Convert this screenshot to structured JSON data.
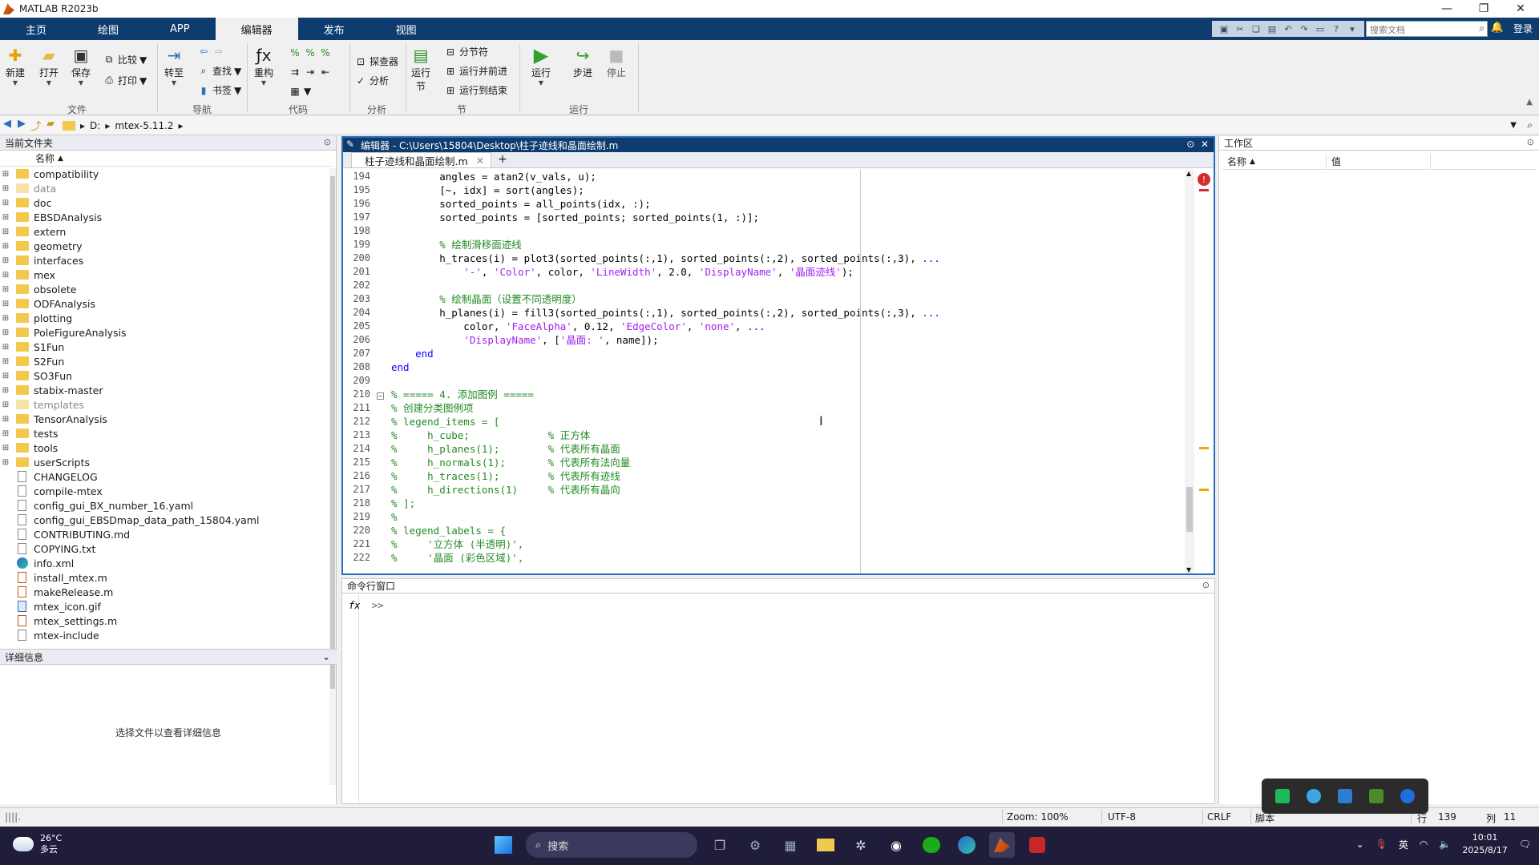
{
  "window": {
    "title": "MATLAB R2023b"
  },
  "tabs": [
    "主页",
    "绘图",
    "APP",
    "编辑器",
    "发布",
    "视图"
  ],
  "active_tab": "编辑器",
  "search": {
    "placeholder": "搜索文档"
  },
  "login": "登录",
  "ribbon": {
    "file": {
      "new": "新建",
      "open": "打开",
      "save": "保存",
      "compare": "比较",
      "print": "打印",
      "group": "文件"
    },
    "nav": {
      "goto": "转至",
      "find": "查找",
      "bookmark": "书签",
      "group": "导航"
    },
    "code": {
      "refactor": "重构",
      "group": "代码"
    },
    "analyze": {
      "explorer": "探查器",
      "analyze": "分析",
      "group": "分析"
    },
    "section": {
      "run_section": "运行节",
      "break": "分节符",
      "run_advance": "运行并前进",
      "run_to_end": "运行到结束",
      "group": "节"
    },
    "run": {
      "run": "运行",
      "step": "步进",
      "stop": "停止",
      "group": "运行"
    }
  },
  "address": {
    "drive": "D:",
    "folder": "mtex-5.11.2"
  },
  "current_folder": {
    "title": "当前文件夹",
    "column": "名称",
    "items": [
      {
        "name": "compatibility",
        "type": "folder"
      },
      {
        "name": "data",
        "type": "folder-dim"
      },
      {
        "name": "doc",
        "type": "folder"
      },
      {
        "name": "EBSDAnalysis",
        "type": "folder"
      },
      {
        "name": "extern",
        "type": "folder"
      },
      {
        "name": "geometry",
        "type": "folder"
      },
      {
        "name": "interfaces",
        "type": "folder"
      },
      {
        "name": "mex",
        "type": "folder"
      },
      {
        "name": "obsolete",
        "type": "folder"
      },
      {
        "name": "ODFAnalysis",
        "type": "folder"
      },
      {
        "name": "plotting",
        "type": "folder"
      },
      {
        "name": "PoleFigureAnalysis",
        "type": "folder"
      },
      {
        "name": "S1Fun",
        "type": "folder"
      },
      {
        "name": "S2Fun",
        "type": "folder"
      },
      {
        "name": "SO3Fun",
        "type": "folder"
      },
      {
        "name": "stabix-master",
        "type": "folder"
      },
      {
        "name": "templates",
        "type": "folder-dim"
      },
      {
        "name": "TensorAnalysis",
        "type": "folder"
      },
      {
        "name": "tests",
        "type": "folder"
      },
      {
        "name": "tools",
        "type": "folder"
      },
      {
        "name": "userScripts",
        "type": "folder"
      },
      {
        "name": "CHANGELOG",
        "type": "file"
      },
      {
        "name": "compile-mtex",
        "type": "file"
      },
      {
        "name": "config_gui_BX_number_16.yaml",
        "type": "file"
      },
      {
        "name": "config_gui_EBSDmap_data_path_15804.yaml",
        "type": "file"
      },
      {
        "name": "CONTRIBUTING.md",
        "type": "file"
      },
      {
        "name": "COPYING.txt",
        "type": "file"
      },
      {
        "name": "info.xml",
        "type": "edge"
      },
      {
        "name": "install_mtex.m",
        "type": "mfile"
      },
      {
        "name": "makeRelease.m",
        "type": "mfile"
      },
      {
        "name": "mtex_icon.gif",
        "type": "gif"
      },
      {
        "name": "mtex_settings.m",
        "type": "mfile"
      },
      {
        "name": "mtex-include",
        "type": "file"
      }
    ]
  },
  "details": {
    "title": "详细信息",
    "message": "选择文件以查看详细信息"
  },
  "editor": {
    "title": "编辑器 - C:\\Users\\15804\\Desktop\\柱子迹线和晶面绘制.m",
    "tab": "柱子迹线和晶面绘制.m",
    "lines": [
      {
        "n": "194",
        "code": "        angles = atan2(v_vals, u);"
      },
      {
        "n": "195",
        "code": "        [~, idx] = sort(angles);"
      },
      {
        "n": "196",
        "code": "        sorted_points = all_points(idx, :);"
      },
      {
        "n": "197",
        "code": "        sorted_points = [sorted_points; sorted_points(1, :)];"
      },
      {
        "n": "198",
        "code": ""
      },
      {
        "n": "199",
        "code": "        % 绘制滑移面迹线"
      },
      {
        "n": "200",
        "code": "        h_traces(i) = plot3(sorted_points(:,1), sorted_points(:,2), sorted_points(:,3), ..."
      },
      {
        "n": "201",
        "code": "            '-', 'Color', color, 'LineWidth', 2.0, 'DisplayName', '晶面迹线');"
      },
      {
        "n": "202",
        "code": ""
      },
      {
        "n": "203",
        "code": "        % 绘制晶面（设置不同透明度）"
      },
      {
        "n": "204",
        "code": "        h_planes(i) = fill3(sorted_points(:,1), sorted_points(:,2), sorted_points(:,3), ..."
      },
      {
        "n": "205",
        "code": "            color, 'FaceAlpha', 0.12, 'EdgeColor', 'none', ..."
      },
      {
        "n": "206",
        "code": "            'DisplayName', ['晶面: ', name]);"
      },
      {
        "n": "207",
        "code": "    end"
      },
      {
        "n": "208",
        "code": "end"
      },
      {
        "n": "209",
        "code": ""
      },
      {
        "n": "210",
        "code": "% ===== 4. 添加图例 ====="
      },
      {
        "n": "211",
        "code": "% 创建分类图例项"
      },
      {
        "n": "212",
        "code": "% legend_items = ["
      },
      {
        "n": "213",
        "code": "%     h_cube;             % 正方体"
      },
      {
        "n": "214",
        "code": "%     h_planes(1);        % 代表所有晶面"
      },
      {
        "n": "215",
        "code": "%     h_normals(1);       % 代表所有法向量"
      },
      {
        "n": "216",
        "code": "%     h_traces(1);        % 代表所有迹线"
      },
      {
        "n": "217",
        "code": "%     h_directions(1)     % 代表所有晶向"
      },
      {
        "n": "218",
        "code": "% ];"
      },
      {
        "n": "219",
        "code": "%"
      },
      {
        "n": "220",
        "code": "% legend_labels = {"
      },
      {
        "n": "221",
        "code": "%     '立方体 (半透明)',"
      },
      {
        "n": "222",
        "code": "%     '晶面 (彩色区域)',"
      }
    ]
  },
  "command_window": {
    "title": "命令行窗口",
    "prompt": ">>"
  },
  "workspace": {
    "title": "工作区",
    "col_name": "名称",
    "col_value": "值"
  },
  "status": {
    "zoom": "Zoom: 100%",
    "encoding": "UTF-8",
    "eol": "CRLF",
    "type": "脚本",
    "row_label": "行",
    "row": "139",
    "col_label": "列",
    "col": "11"
  },
  "taskbar": {
    "temp": "26°C",
    "weather": "多云",
    "search": "搜索",
    "ime": "英",
    "time": "10:01",
    "date": "2025/8/17"
  },
  "colors": {
    "ribbon_tab_bg": "#0e3c6e",
    "editor_border": "#2a6ebb",
    "keyword": "#0e00ff",
    "comment": "#228b22",
    "string": "#a020f0"
  }
}
